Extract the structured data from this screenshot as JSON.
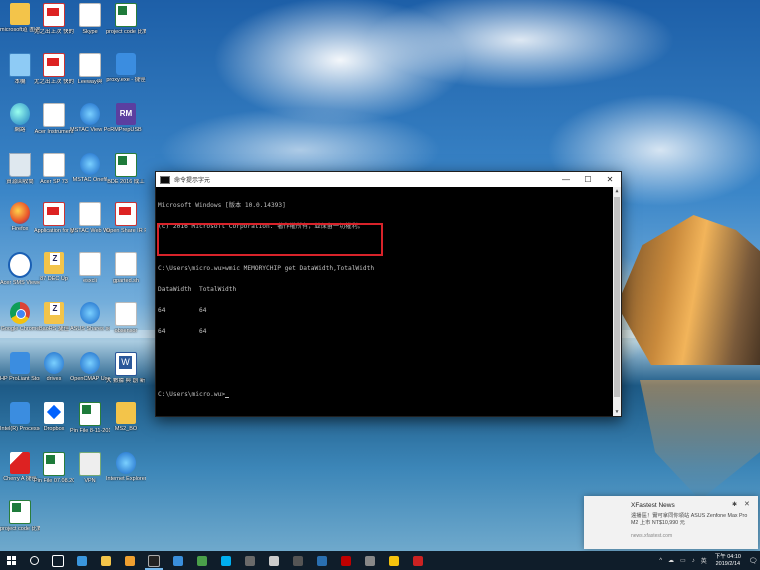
{
  "desktop": {
    "icons": [
      {
        "label": "microsoft道 圍選 - 捷徑",
        "glyph": "user-folder-icon"
      },
      {
        "label": "尤之出上次 快的 捷徑",
        "glyph": "pdf-icon"
      },
      {
        "label": "Skype",
        "glyph": "document-icon"
      },
      {
        "label": "project code 比對之",
        "glyph": "excel-icon"
      },
      {
        "label": "本機",
        "glyph": "this-pc-icon"
      },
      {
        "label": "尤之出上次 快的 捷徑",
        "glyph": "pdf-icon"
      },
      {
        "label": "Leeway與",
        "glyph": "word-doc-icon"
      },
      {
        "label": "proxy.exe - 捷徑",
        "glyph": "network-icon"
      },
      {
        "label": "網路",
        "glyph": "network-globe-icon"
      },
      {
        "label": "Acer Instrument",
        "glyph": "document-icon"
      },
      {
        "label": "MSTAC View Portal",
        "glyph": "ie-icon"
      },
      {
        "label": "RMPrepUSB",
        "glyph": "rm-icon"
      },
      {
        "label": "資源回收筒",
        "glyph": "recycle-bin-icon"
      },
      {
        "label": "Acer SP 73",
        "glyph": "document-icon"
      },
      {
        "label": "MSTAC Onefil",
        "glyph": "ie-icon"
      },
      {
        "label": "BDE 2016 成工",
        "glyph": "excel-icon"
      },
      {
        "label": "Firefox",
        "glyph": "firefox-icon"
      },
      {
        "label": "Application for general",
        "glyph": "pdf-icon"
      },
      {
        "label": "MSTAC Web Wall 2018",
        "glyph": "document-icon"
      },
      {
        "label": "Open Share IR Feedback",
        "glyph": "pdf-icon"
      },
      {
        "label": "Acer SMS Viewer",
        "glyph": "help-icon"
      },
      {
        "label": "87 DEC Up",
        "glyph": "zip-folder-icon"
      },
      {
        "label": "esxcli",
        "glyph": "document-icon"
      },
      {
        "label": "gparted.sh",
        "glyph": "document-icon"
      },
      {
        "label": "Google Chrome",
        "glyph": "chrome-icon"
      },
      {
        "label": "BaoRS 捷徑",
        "glyph": "zip-folder-icon"
      },
      {
        "label": "ASUS Shares setup",
        "glyph": "ie-icon"
      },
      {
        "label": "obsensor",
        "glyph": "document-icon"
      },
      {
        "label": "HP ProLiant Storage F",
        "glyph": "hp-icon"
      },
      {
        "label": "drives",
        "glyph": "ie-icon"
      },
      {
        "label": "OpenCMAP User Guide",
        "glyph": "ie-icon"
      },
      {
        "label": "大 數據 與 創 新 應 用",
        "glyph": "word-icon"
      },
      {
        "label": "Intel(R) Processor",
        "glyph": "intel-icon"
      },
      {
        "label": "Dropbox",
        "glyph": "dropbox-icon"
      },
      {
        "label": "Pin File 8-11-2018",
        "glyph": "excel-icon"
      },
      {
        "label": "MS2_BO",
        "glyph": "folder-icon"
      },
      {
        "label": "Cherry A 捷徑",
        "glyph": "red-triangle-icon"
      },
      {
        "label": "Pin File 07.08.2019",
        "glyph": "excel-icon"
      },
      {
        "label": "VPN",
        "glyph": "vpn-icon"
      },
      {
        "label": "Internet Explorer",
        "glyph": "ie-icon"
      },
      {
        "label": "project code 比對之",
        "glyph": "excel-icon"
      }
    ]
  },
  "cmd": {
    "title": "命令提示字元",
    "minimize": "—",
    "maximize": "☐",
    "close": "✕",
    "lines": [
      "Microsoft Windows [版本 10.0.14393]",
      "(c) 2016 Microsoft Corporation. 著作權所有，並保留一切權利。",
      "",
      "C:\\Users\\micro.wu>wmic MEMORYCHIP get DataWidth,TotalWidth",
      "DataWidth  TotalWidth",
      "64         64",
      "64         64",
      "",
      "",
      "C:\\Users\\micro.wu>"
    ]
  },
  "toast": {
    "app": "XFastest News",
    "body": "遠播區！實可拿同你領站 ASUS Zenfone Max Pro M2 上市 NT$10,990 元",
    "source": "news.xfastest.com",
    "settings_icon": "gear-icon",
    "close": "✕"
  },
  "taskbar": {
    "buttons": [
      {
        "name": "search",
        "icon": "search-icon",
        "color": "#ffffff"
      },
      {
        "name": "task-view",
        "icon": "task-view-icon",
        "color": "#ffffff"
      },
      {
        "name": "edge",
        "icon": "edge-icon",
        "color": "#3a96dd"
      },
      {
        "name": "file-explorer",
        "icon": "folder-icon",
        "color": "#f3c44a"
      },
      {
        "name": "store",
        "icon": "store-icon",
        "color": "#f0a030"
      },
      {
        "name": "cmd",
        "icon": "cmd-icon",
        "color": "#222222"
      },
      {
        "name": "mail",
        "icon": "mail-icon",
        "color": "#3a8fdc"
      },
      {
        "name": "app-1",
        "icon": "app-icon",
        "color": "#4a9f4a"
      },
      {
        "name": "skype",
        "icon": "skype-icon",
        "color": "#00aff0"
      },
      {
        "name": "app-2",
        "icon": "app-icon",
        "color": "#6a6a6a"
      },
      {
        "name": "app-3",
        "icon": "document-icon",
        "color": "#cccccc"
      },
      {
        "name": "calculator",
        "icon": "calculator-icon",
        "color": "#555555"
      },
      {
        "name": "app-4",
        "icon": "app-icon",
        "color": "#2a6fb0"
      },
      {
        "name": "filezilla",
        "icon": "filezilla-icon",
        "color": "#bf0000"
      },
      {
        "name": "app-5",
        "icon": "app-icon",
        "color": "#888888"
      },
      {
        "name": "chrome",
        "icon": "chrome-icon",
        "color": "#f4c20d"
      },
      {
        "name": "app-6",
        "icon": "app-icon",
        "color": "#cc2222"
      }
    ],
    "tray_icons": [
      "^",
      "☁",
      "▭",
      "♪",
      "英"
    ],
    "time": "下午 04:10",
    "date": "2019/2/14",
    "notifications": "🗨"
  }
}
